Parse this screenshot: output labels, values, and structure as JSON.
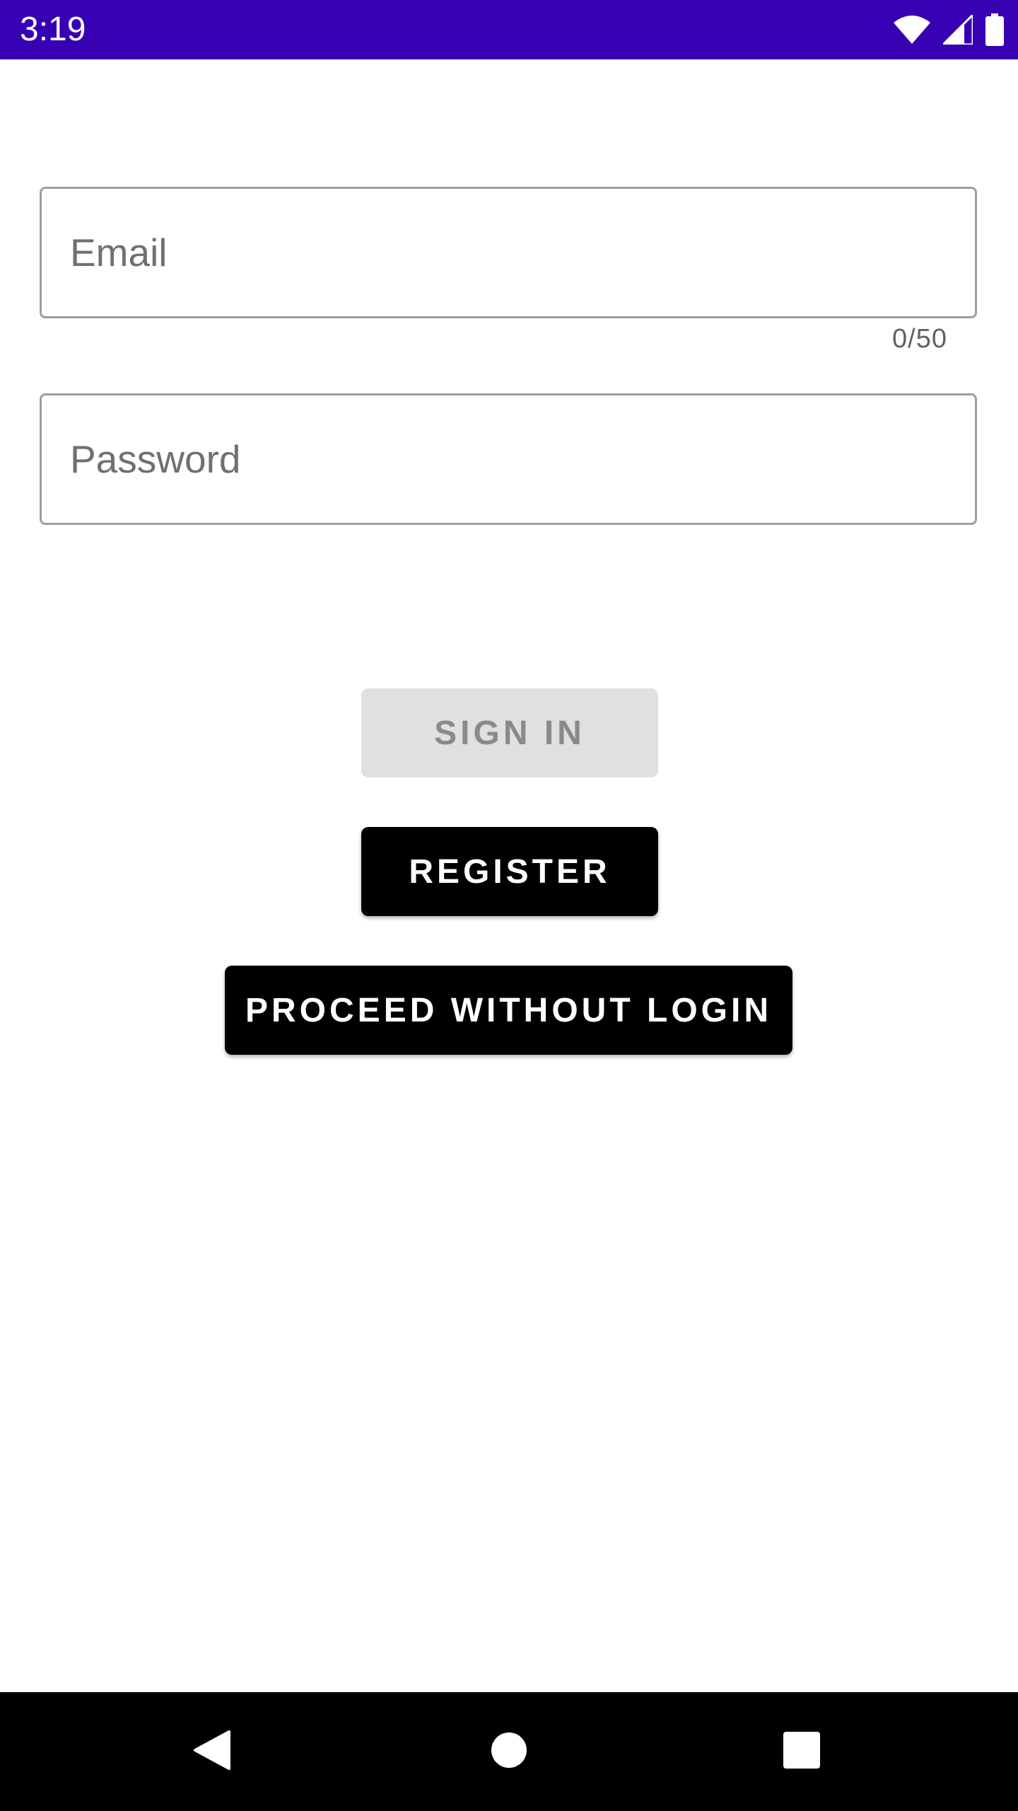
{
  "status_bar": {
    "time": "3:19",
    "background_color": "#3700b3",
    "icons": [
      "wifi-icon",
      "cell-signal-icon",
      "battery-icon"
    ]
  },
  "form": {
    "email": {
      "placeholder": "Email",
      "value": "",
      "counter": "0/50"
    },
    "password": {
      "placeholder": "Password",
      "value": ""
    }
  },
  "buttons": {
    "sign_in": "SIGN IN",
    "register": "REGISTER",
    "proceed": "PROCEED WITHOUT LOGIN"
  },
  "nav_bar": {
    "icons": [
      "back-icon",
      "home-icon",
      "recents-icon"
    ]
  }
}
